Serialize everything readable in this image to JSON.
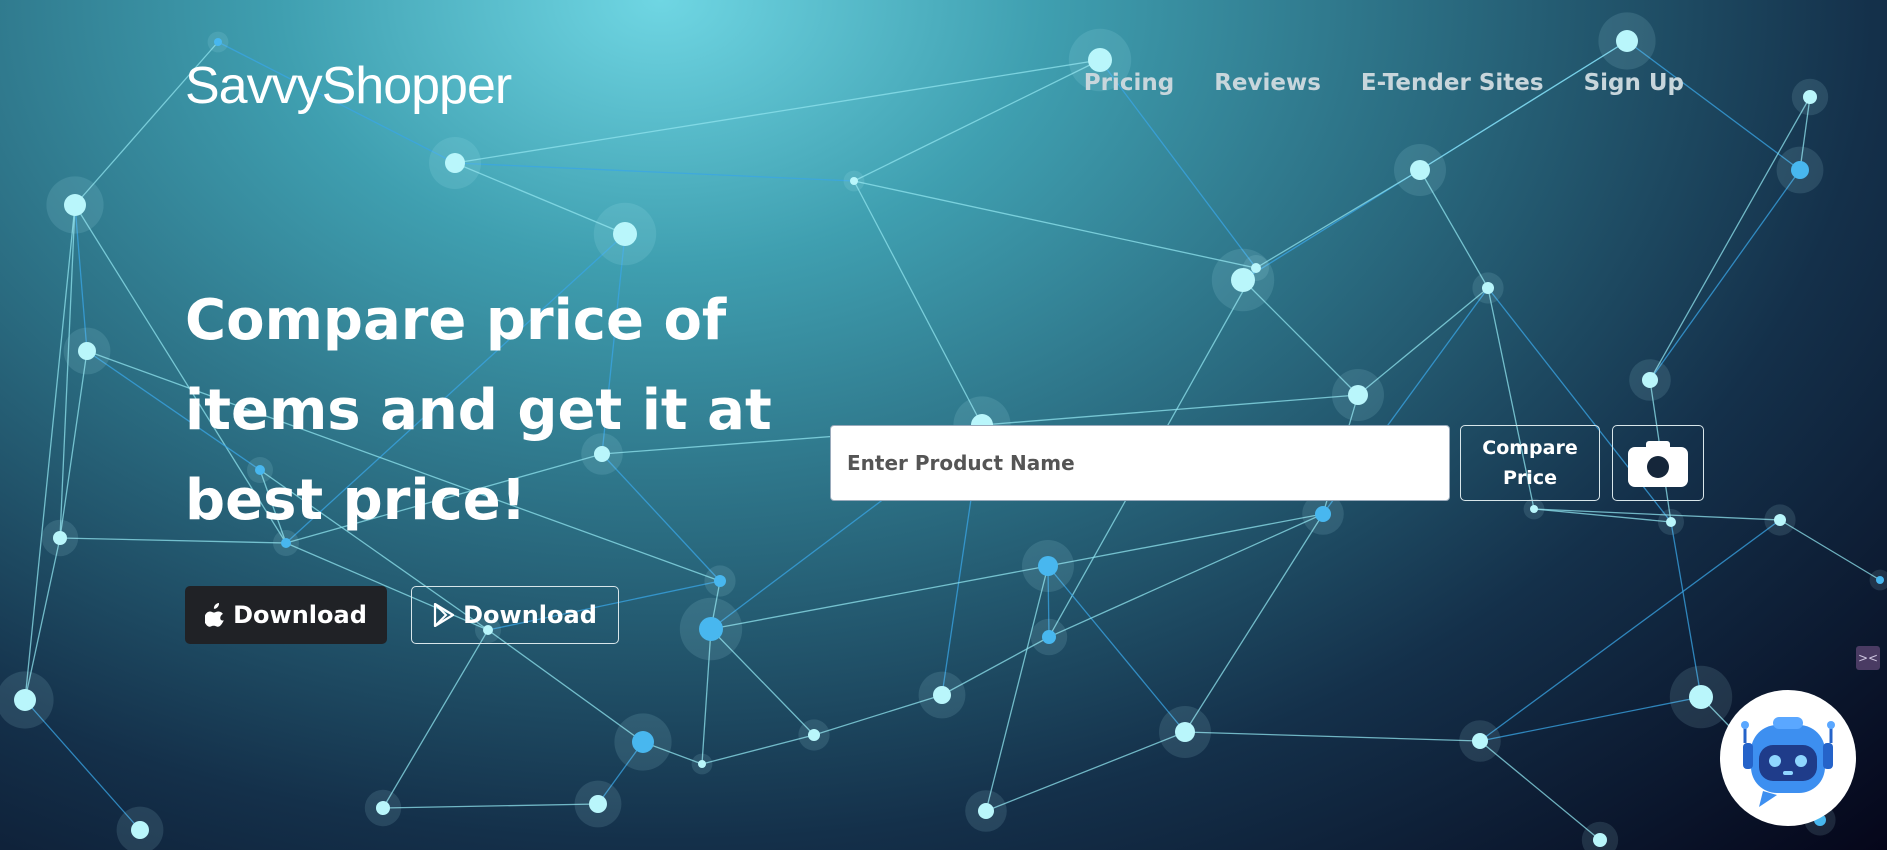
{
  "brand": {
    "logo_text": "SavvyShopper"
  },
  "nav": {
    "items": [
      {
        "label": "Pricing"
      },
      {
        "label": "Reviews"
      },
      {
        "label": "E-Tender Sites"
      },
      {
        "label": "Sign Up"
      }
    ]
  },
  "hero": {
    "headline_line1": "Compare price of",
    "headline_line2": "items and get it at",
    "headline_line3": "best price!",
    "download_ios": {
      "label": "Download",
      "icon": "apple-icon"
    },
    "download_play": {
      "label": "Download",
      "icon": "google-play-icon"
    }
  },
  "search": {
    "placeholder": "Enter Product Name",
    "value": "",
    "compare_label": "Compare Price",
    "camera_icon": "camera-icon"
  },
  "widgets": {
    "minimize_icon": "collapse-icon",
    "chatbot_icon": "robot-chat-icon"
  },
  "colors": {
    "accent": "#5ac8e8",
    "dark_button": "#202226",
    "text_light": "#ffffff",
    "nav_text": "#c8d6dc"
  }
}
